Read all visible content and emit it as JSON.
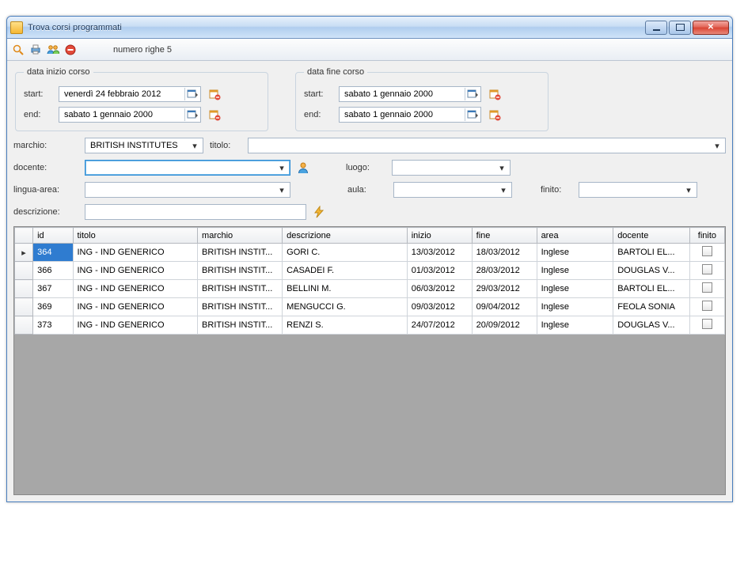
{
  "window": {
    "title": "Trova corsi programmati"
  },
  "toolbar": {
    "row_count_label": "numero righe 5"
  },
  "groups": {
    "start_group_title": "data inizio corso",
    "end_group_title": "data fine corso",
    "start_label": "start:",
    "end_label": "end:",
    "inizio": {
      "start": "venerdì   24  febbraio   2012",
      "end": "sabato     1  gennaio   2000"
    },
    "fine": {
      "start": "sabato     1  gennaio   2000",
      "end": "sabato     1  gennaio   2000"
    }
  },
  "labels": {
    "marchio": "marchio:",
    "titolo": "titolo:",
    "docente": "docente:",
    "luogo": "luogo:",
    "lingua_area": "lingua-area:",
    "aula": "aula:",
    "finito": "finito:",
    "descrizione": "descrizione:"
  },
  "values": {
    "marchio": "BRITISH INSTITUTES",
    "titolo": "",
    "docente": "",
    "luogo": "",
    "lingua_area": "",
    "aula": "",
    "finito": "",
    "descrizione": ""
  },
  "grid": {
    "columns": [
      "",
      "id",
      "titolo",
      "marchio",
      "descrizione",
      "inizio",
      "fine",
      "area",
      "docente",
      "finito"
    ],
    "rows": [
      {
        "selected": true,
        "id": "364",
        "titolo": "ING - IND GENERICO",
        "marchio": "BRITISH INSTIT...",
        "descrizione": "GORI C.",
        "inizio": "13/03/2012",
        "fine": "18/03/2012",
        "area": "Inglese",
        "docente": "BARTOLI EL...",
        "finito": false
      },
      {
        "selected": false,
        "id": "366",
        "titolo": "ING - IND GENERICO",
        "marchio": "BRITISH INSTIT...",
        "descrizione": "CASADEI F.",
        "inizio": "01/03/2012",
        "fine": "28/03/2012",
        "area": "Inglese",
        "docente": "DOUGLAS V...",
        "finito": false
      },
      {
        "selected": false,
        "id": "367",
        "titolo": "ING - IND GENERICO",
        "marchio": "BRITISH INSTIT...",
        "descrizione": "BELLINI M.",
        "inizio": "06/03/2012",
        "fine": "29/03/2012",
        "area": "Inglese",
        "docente": "BARTOLI EL...",
        "finito": false
      },
      {
        "selected": false,
        "id": "369",
        "titolo": "ING - IND GENERICO",
        "marchio": "BRITISH INSTIT...",
        "descrizione": "MENGUCCI G.",
        "inizio": "09/03/2012",
        "fine": "09/04/2012",
        "area": "Inglese",
        "docente": "FEOLA SONIA",
        "finito": false
      },
      {
        "selected": false,
        "id": "373",
        "titolo": "ING - IND GENERICO",
        "marchio": "BRITISH INSTIT...",
        "descrizione": "RENZI S.",
        "inizio": "24/07/2012",
        "fine": "20/09/2012",
        "area": "Inglese",
        "docente": "DOUGLAS V...",
        "finito": false
      }
    ]
  }
}
